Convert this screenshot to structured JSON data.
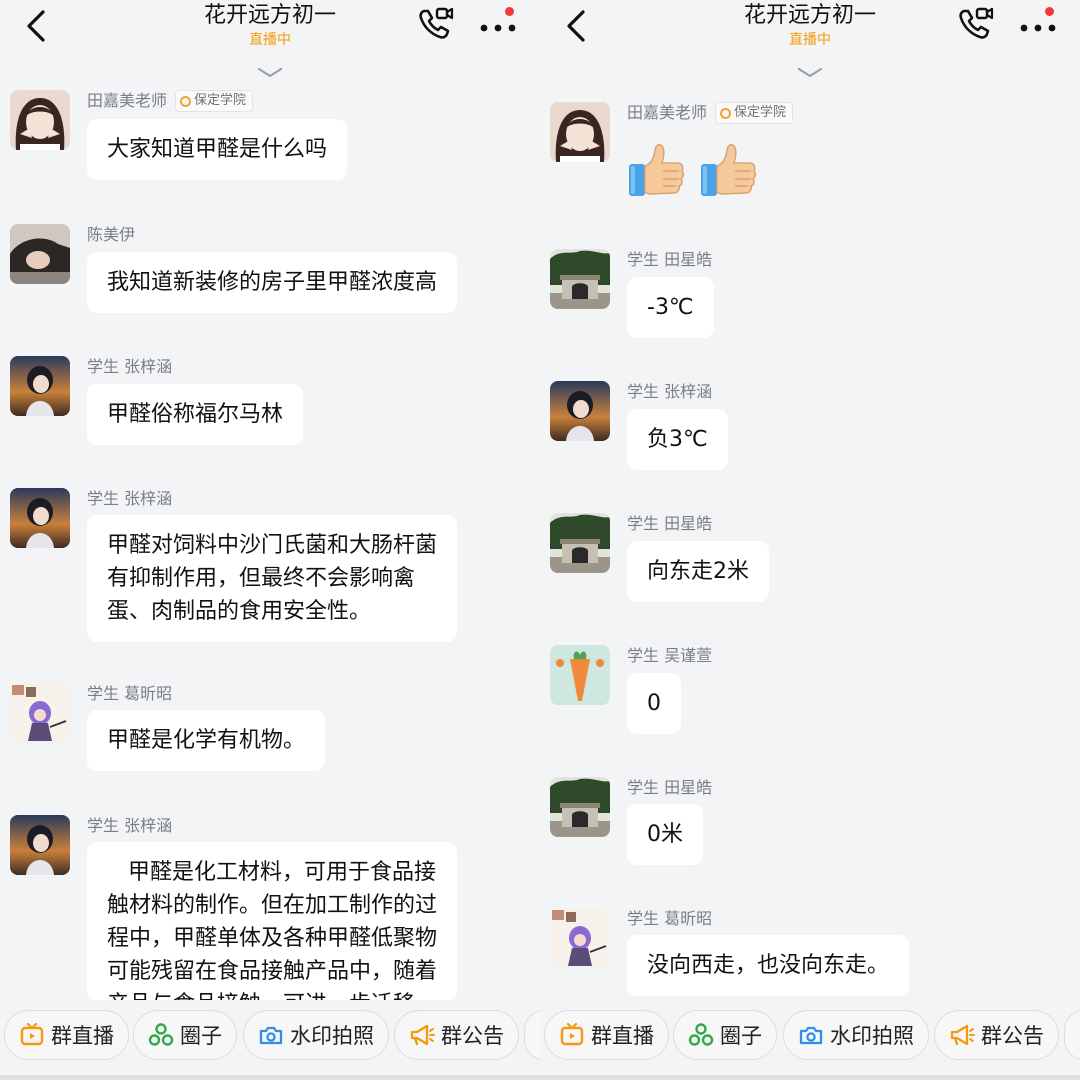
{
  "colors": {
    "accent": "#f49b0b",
    "badge_red": "#f2393a",
    "bubble": "#ffffff",
    "background": "#f3f4f6"
  },
  "left": {
    "header": {
      "title": "花开远方初一",
      "status": "直播中",
      "back_icon": "chevron-left-icon",
      "call_icon": "phone-call-icon",
      "more_icon": "more-dots-icon"
    },
    "messages": [
      {
        "sender": "田嘉美老师",
        "tag": "保定学院",
        "text": "大家知道甲醛是什么吗"
      },
      {
        "sender": "陈美伊",
        "text": "我知道新装修的房子里甲醛浓度高"
      },
      {
        "sender": "学生 张梓涵",
        "text": "甲醛俗称福尔马林"
      },
      {
        "sender": "学生 张梓涵",
        "text": "甲醛对饲料中沙门氏菌和大肠杆菌\n有抑制作用，但最终不会影响禽\n蛋、肉制品的食用安全性。"
      },
      {
        "sender": "学生 葛昕昭",
        "text": "甲醛是化学有机物。"
      },
      {
        "sender": "学生 张梓涵",
        "text": "   甲醛是化工材料，可用于食品接\n触材料的制作。但在加工制作的过\n程中，甲醛单体及各种甲醛低聚物\n可能残留在食品接触产品中，随着\n产品与食品接触，可进一步迁移"
      }
    ],
    "toolbar": [
      "群直播",
      "圈子",
      "水印拍照",
      "群公告"
    ]
  },
  "right": {
    "header": {
      "title": "花开远方初一",
      "status": "直播中",
      "back_icon": "chevron-left-icon",
      "call_icon": "phone-call-icon",
      "more_icon": "more-dots-icon"
    },
    "messages": [
      {
        "sender": "田嘉美老师",
        "tag": "保定学院",
        "emoji": "thumbs-up-icon thumbs-up-icon"
      },
      {
        "sender": "学生 田星皓",
        "text": "-3℃"
      },
      {
        "sender": "学生 张梓涵",
        "text": "负3℃"
      },
      {
        "sender": "学生 田星皓",
        "text": "向东走2米"
      },
      {
        "sender": "学生 吴谨萱",
        "text": "0"
      },
      {
        "sender": "学生 田星皓",
        "text": "0米"
      },
      {
        "sender": "学生 葛昕昭",
        "text": "没向西走，也没向东走。"
      }
    ],
    "toolbar": [
      "群直播",
      "圈子",
      "水印拍照",
      "群公告"
    ]
  }
}
